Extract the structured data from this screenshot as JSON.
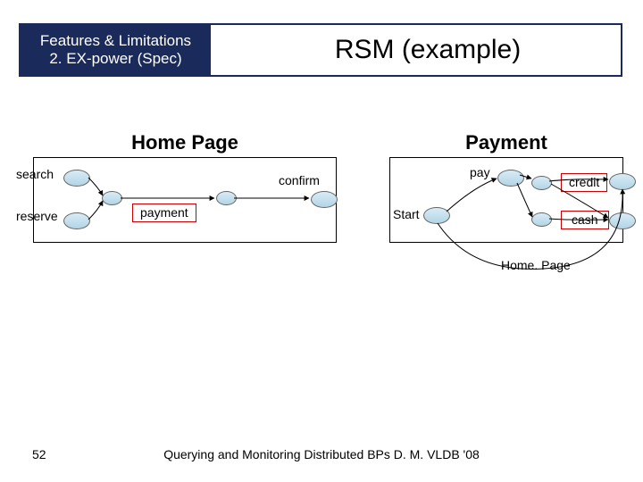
{
  "header": {
    "breadcrumb_line1": "Features & Limitations",
    "breadcrumb_line2": "2. EX-power (Spec)",
    "title": "RSM (example)"
  },
  "modules": {
    "home": {
      "title": "Home Page"
    },
    "payment": {
      "title": "Payment"
    }
  },
  "labels": {
    "search": "search",
    "reserve": "reserve",
    "payment": "payment",
    "confirm": "confirm",
    "pay": "pay",
    "credit": "credit",
    "cash": "cash",
    "start": "Start",
    "homepage": "Home. Page"
  },
  "footer": {
    "text": "Querying and Monitoring Distributed BPs D. M. VLDB '08",
    "slide": "52"
  }
}
